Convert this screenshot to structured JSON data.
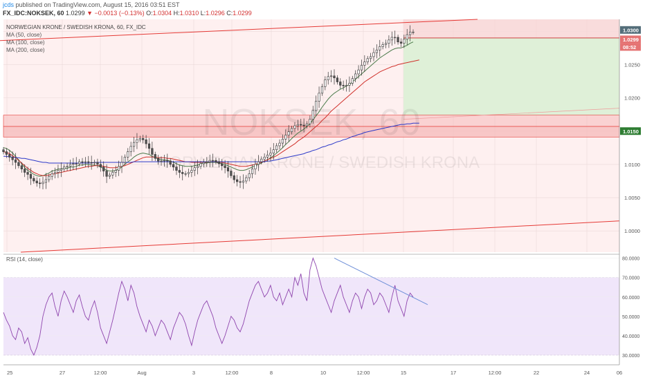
{
  "header": {
    "user": "jcds",
    "published": "published on TradingView.com, August 15, 2016 03:51 EST",
    "symbol": "FX_IDC:NOKSEK, 60",
    "last": "1.0299",
    "change": "−0.0013 (−0.13%)",
    "open_label": "O:",
    "open": "1.0304",
    "high_label": "H:",
    "high": "1.0310",
    "low_label": "L:",
    "low": "1.0296",
    "close_label": "C:",
    "close": "1.0299"
  },
  "legend": {
    "title": "NORWEGIAN KRONE / SWEDISH KRONA, 60, FX_IDC",
    "ma50": "MA (50, close)",
    "ma100": "MA (100, close)",
    "ma200": "MA (200, close)",
    "rsi": "RSI (14, close)"
  },
  "watermark": {
    "symbol": "NOKSEK, 60",
    "name": "NORWEGIAN KRONE / SWEDISH KRONA"
  },
  "colors": {
    "up": "#26a69a",
    "down": "#ef5350",
    "candle_body_up": "#ffffff",
    "candle_body_down": "#555555",
    "ma50": "#4a7a4a",
    "ma100": "#d0302a",
    "ma200": "#2a38c8",
    "rsi": "#8e44ad",
    "channel": "#e53935",
    "pink_zone": "#fde4e4",
    "green_zone": "#dff0d8",
    "rsi_band": "#f0e6fa",
    "trendline": "#6e8fd8"
  },
  "price_labels": {
    "high_tag": "1.0300",
    "last_tag": "1.0299",
    "countdown": "08:52",
    "support_tag": "1.0150"
  },
  "chart_data": {
    "type": "candlestick",
    "title": "NORWEGIAN KRONE / SWEDISH KRONA, 60, FX_IDC",
    "price_axis": {
      "ticks": [
        "1.0300",
        "1.0250",
        "1.0200",
        "1.0150",
        "1.0100",
        "1.0050",
        "1.0000"
      ],
      "ylim": [
        0.9968,
        1.0318
      ]
    },
    "time_axis": {
      "ticks": [
        "25",
        "27",
        "12:00",
        "Aug",
        "3",
        "12:00",
        "8",
        "10",
        "12:00",
        "15",
        "17",
        "12:00",
        "22",
        "24",
        "06"
      ]
    },
    "rsi_axis": {
      "ticks": [
        "80.0000",
        "70.0000",
        "60.0000",
        "50.0000",
        "40.0000",
        "30.0000"
      ],
      "ylim": [
        25,
        82
      ],
      "overbought": 70,
      "oversold": 30
    },
    "levels": {
      "resistance_zone": [
        1.0157,
        1.0174
      ],
      "support_zone": [
        1.0141,
        1.0157
      ],
      "target": 1.029,
      "support": 1.015
    },
    "channel": {
      "upper": [
        [
          0,
          1.0286
        ],
        [
          690,
          1.0318
        ]
      ],
      "lower": [
        [
          30,
          0.9968
        ],
        [
          895,
          1.0015
        ]
      ]
    },
    "rsi_trendline": [
      [
        483,
        80
      ],
      [
        618,
        56
      ]
    ],
    "series": [
      {
        "name": "NOKSEK",
        "close": [
          1.0119,
          1.0115,
          1.0111,
          1.0107,
          1.0103,
          1.0098,
          1.0093,
          1.0088,
          1.0085,
          1.0079,
          1.0075,
          1.0072,
          1.0071,
          1.0073,
          1.0077,
          1.0082,
          1.0086,
          1.0088,
          1.0091,
          1.0093,
          1.0096,
          1.0097,
          1.01,
          1.0101,
          1.0101,
          1.0104,
          1.0103,
          1.0104,
          1.0103,
          1.0102,
          1.0103,
          1.01,
          1.0096,
          1.009,
          1.0082,
          1.0084,
          1.0088,
          1.0091,
          1.0097,
          1.0103,
          1.0111,
          1.0119,
          1.0127,
          1.0133,
          1.0137,
          1.0139,
          1.0137,
          1.0131,
          1.0124,
          1.0115,
          1.0109,
          1.0105,
          1.0105,
          1.0106,
          1.0105,
          1.01,
          1.0096,
          1.0091,
          1.0088,
          1.0086,
          1.0086,
          1.0088,
          1.0091,
          1.0095,
          1.0097,
          1.0101,
          1.0103,
          1.0104,
          1.0106,
          1.0106,
          1.0104,
          1.0101,
          1.0098,
          1.0095,
          1.009,
          1.0083,
          1.0077,
          1.0074,
          1.0073,
          1.0075,
          1.008,
          1.0086,
          1.0093,
          1.01,
          1.0104,
          1.0108,
          1.0111,
          1.0114,
          1.0117,
          1.0122,
          1.0128,
          1.0132,
          1.0138,
          1.0144,
          1.0149,
          1.0154,
          1.0158,
          1.016,
          1.0159,
          1.0158,
          1.0161,
          1.0168,
          1.0181,
          1.0195,
          1.0207,
          1.0217,
          1.0227,
          1.0232,
          1.0233,
          1.023,
          1.0224,
          1.0219,
          1.0218,
          1.0219,
          1.0222,
          1.0229,
          1.0236,
          1.0242,
          1.0249,
          1.0254,
          1.0259,
          1.0262,
          1.0268,
          1.0272,
          1.0277,
          1.028,
          1.0282,
          1.0287,
          1.0291,
          1.0291,
          1.0284,
          1.0282,
          1.0288,
          1.0295,
          1.0299,
          1.0299
        ]
      },
      {
        "name": "MA (50, close)",
        "values": [
          1.0125,
          1.0124,
          1.0121,
          1.0117,
          1.0112,
          1.0107,
          1.0101,
          1.0095,
          1.0091,
          1.0088,
          1.0085,
          1.0083,
          1.0082,
          1.0083,
          1.0085,
          1.0087,
          1.009,
          1.0091,
          1.0093,
          1.0093,
          1.0094,
          1.0094,
          1.0096,
          1.0096,
          1.0097,
          1.0099,
          1.0099,
          1.01,
          1.01,
          1.0099,
          1.0099,
          1.0098,
          1.0096,
          1.0094,
          1.0091,
          1.009,
          1.009,
          1.0091,
          1.0093,
          1.0096,
          1.01,
          1.0104,
          1.0107,
          1.0111,
          1.0114,
          1.0116,
          1.0117,
          1.0116,
          1.0115,
          1.0112,
          1.011,
          1.0108,
          1.0107,
          1.0107,
          1.0106,
          1.0105,
          1.0103,
          1.0101,
          1.0099,
          1.0098,
          1.0097,
          1.0097,
          1.0097,
          1.0098,
          1.0099,
          1.0101,
          1.0102,
          1.0102,
          1.0103,
          1.0103,
          1.0103,
          1.0102,
          1.0101,
          1.01,
          1.0098,
          1.0096,
          1.0094,
          1.0092,
          1.0091,
          1.0091,
          1.0092,
          1.0094,
          1.0096,
          1.0098,
          1.01,
          1.0102,
          1.0105,
          1.0107,
          1.011,
          1.0113,
          1.0117,
          1.0121,
          1.0125,
          1.013,
          1.0134,
          1.0139,
          1.0143,
          1.0147,
          1.015,
          1.0153,
          1.0157,
          1.0161,
          1.0167,
          1.0173,
          1.0179,
          1.0186,
          1.0192,
          1.0198,
          1.0203,
          1.0207,
          1.021,
          1.0213,
          1.0215,
          1.0218,
          1.022,
          1.0224,
          1.0228,
          1.0232,
          1.0236,
          1.024,
          1.0244,
          1.0248,
          1.0252,
          1.0256,
          1.026,
          1.0263,
          1.0266,
          1.0269,
          1.0272,
          1.0274,
          1.0275,
          1.0275,
          1.0277,
          1.0279,
          1.0282,
          1.0284
        ]
      },
      {
        "name": "MA (100, close)",
        "values": [
          1.0119,
          1.0118,
          1.0116,
          1.0113,
          1.011,
          1.0106,
          1.0102,
          1.0098,
          1.0094,
          1.0091,
          1.0088,
          1.0086,
          1.0084,
          1.0083,
          1.0083,
          1.0084,
          1.0085,
          1.0086,
          1.0087,
          1.0088,
          1.0089,
          1.009,
          1.0091,
          1.0092,
          1.0093,
          1.0094,
          1.0095,
          1.0096,
          1.0097,
          1.0097,
          1.0098,
          1.0098,
          1.0098,
          1.0097,
          1.0096,
          1.0095,
          1.0095,
          1.0095,
          1.0096,
          1.0097,
          1.0098,
          1.01,
          1.0102,
          1.0104,
          1.0106,
          1.0108,
          1.011,
          1.0111,
          1.0111,
          1.0111,
          1.0111,
          1.011,
          1.011,
          1.011,
          1.0109,
          1.0109,
          1.0108,
          1.0107,
          1.0106,
          1.0105,
          1.0104,
          1.0104,
          1.0103,
          1.0103,
          1.0103,
          1.0103,
          1.0103,
          1.0103,
          1.0104,
          1.0104,
          1.0104,
          1.0103,
          1.0103,
          1.0102,
          1.0101,
          1.01,
          1.0099,
          1.0098,
          1.0097,
          1.0097,
          1.0097,
          1.0098,
          1.0099,
          1.01,
          1.0102,
          1.0103,
          1.0105,
          1.0107,
          1.0109,
          1.0111,
          1.0113,
          1.0116,
          1.0119,
          1.0122,
          1.0125,
          1.0128,
          1.0131,
          1.0135,
          1.0138,
          1.0141,
          1.0145,
          1.0149,
          1.0153,
          1.0157,
          1.0161,
          1.0166,
          1.017,
          1.0175,
          1.018,
          1.0184,
          1.0188,
          1.0192,
          1.0196,
          1.02,
          1.0204,
          1.0208,
          1.0212,
          1.0216,
          1.022,
          1.0224,
          1.0227,
          1.023,
          1.0233,
          1.0236,
          1.0239,
          1.0241,
          1.0243,
          1.0245,
          1.0247,
          1.0248,
          1.025,
          1.0251,
          1.0252,
          1.0253,
          1.0254,
          1.0255,
          1.0256,
          1.0257
        ]
      },
      {
        "name": "MA (200, close)",
        "values": [
          1.0112,
          1.0112,
          1.0111,
          1.0111,
          1.011,
          1.011,
          1.0109,
          1.0109,
          1.0108,
          1.0107,
          1.0106,
          1.0105,
          1.0104,
          1.0103,
          1.0103,
          1.0102,
          1.0102,
          1.0102,
          1.0102,
          1.0102,
          1.0102,
          1.0102,
          1.0102,
          1.0102,
          1.0102,
          1.0102,
          1.0102,
          1.0102,
          1.0102,
          1.0102,
          1.0103,
          1.0103,
          1.0103,
          1.0103,
          1.0103,
          1.0103,
          1.0103,
          1.0103,
          1.0103,
          1.0103,
          1.0103,
          1.0103,
          1.0103,
          1.0104,
          1.0104,
          1.0104,
          1.0104,
          1.0104,
          1.0104,
          1.0104,
          1.0104,
          1.0104,
          1.0104,
          1.0104,
          1.0104,
          1.0104,
          1.0104,
          1.0104,
          1.0104,
          1.0104,
          1.0104,
          1.0104,
          1.0104,
          1.0104,
          1.0104,
          1.0104,
          1.0104,
          1.0104,
          1.0104,
          1.0104,
          1.0104,
          1.0104,
          1.0104,
          1.0104,
          1.0104,
          1.0104,
          1.0104,
          1.0104,
          1.0104,
          1.0104,
          1.0104,
          1.0104,
          1.0104,
          1.0104,
          1.0104,
          1.0104,
          1.0104,
          1.0105,
          1.0105,
          1.0106,
          1.0107,
          1.0108,
          1.0109,
          1.011,
          1.0111,
          1.0112,
          1.0113,
          1.0114,
          1.0115,
          1.0116,
          1.0118,
          1.0119,
          1.0121,
          1.0122,
          1.0124,
          1.0126,
          1.0127,
          1.0129,
          1.013,
          1.0132,
          1.0134,
          1.0135,
          1.0137,
          1.0138,
          1.014,
          1.0142,
          1.0143,
          1.0145,
          1.0146,
          1.0148,
          1.0149,
          1.015,
          1.0151,
          1.0152,
          1.0153,
          1.0154,
          1.0155,
          1.0156,
          1.0157,
          1.0158,
          1.0159,
          1.016,
          1.016,
          1.0161,
          1.0161,
          1.0162,
          1.0162,
          1.0162
        ]
      },
      {
        "name": "RSI (14, close)",
        "values": [
          52,
          48,
          45,
          40,
          38,
          44,
          42,
          36,
          39,
          33,
          30,
          34,
          40,
          50,
          56,
          60,
          62,
          55,
          50,
          58,
          63,
          60,
          56,
          52,
          58,
          61,
          55,
          50,
          48,
          54,
          58,
          52,
          44,
          40,
          36,
          42,
          48,
          55,
          62,
          68,
          64,
          58,
          66,
          62,
          55,
          50,
          46,
          42,
          48,
          45,
          40,
          44,
          48,
          46,
          42,
          38,
          44,
          48,
          52,
          50,
          46,
          40,
          35,
          42,
          48,
          52,
          56,
          58,
          54,
          50,
          44,
          40,
          36,
          40,
          45,
          50,
          48,
          44,
          42,
          46,
          52,
          58,
          62,
          66,
          68,
          64,
          60,
          62,
          66,
          60,
          58,
          62,
          56,
          60,
          64,
          60,
          70,
          66,
          72,
          62,
          58,
          74,
          80,
          76,
          70,
          64,
          60,
          56,
          52,
          58,
          62,
          66,
          60,
          56,
          52,
          58,
          62,
          60,
          54,
          60,
          64,
          62,
          56,
          58,
          62,
          60,
          56,
          52,
          60,
          66,
          58,
          54,
          50,
          58,
          62,
          60
        ]
      }
    ]
  }
}
